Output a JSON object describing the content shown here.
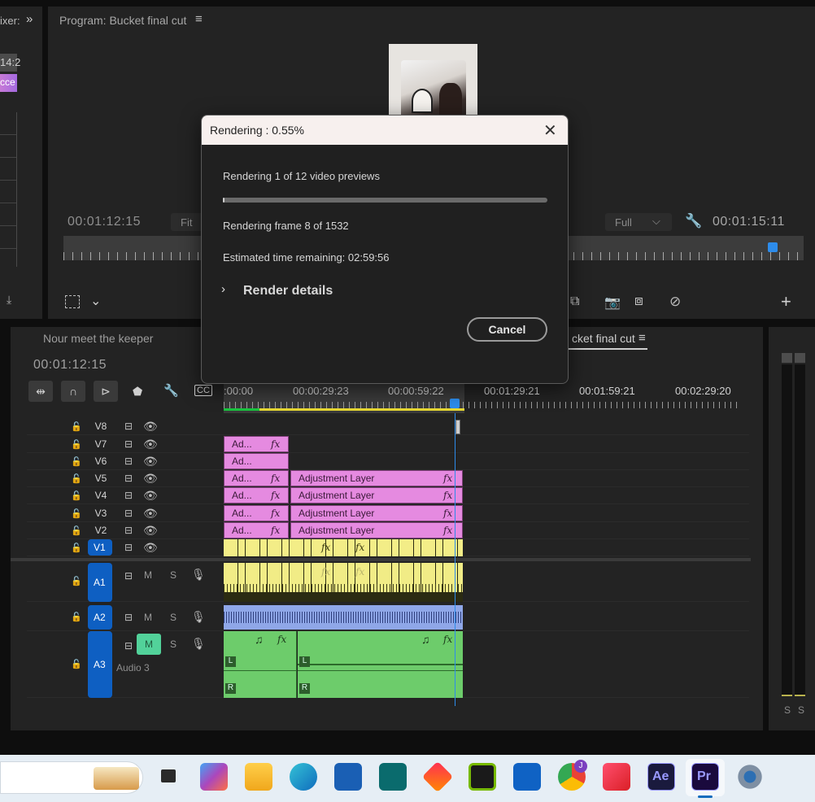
{
  "left_panel": {
    "tab_fragment": "ixer:",
    "timecode_fragment": "14:2",
    "clip_fragment": "cce"
  },
  "program_monitor": {
    "title": "Program: Bucket final cut",
    "timecode_left": "00:01:12:15",
    "fit_label": "Fit",
    "quality_label": "Full",
    "timecode_right": "00:01:15:11"
  },
  "timeline": {
    "tab_left": "Nour meet the keeper",
    "tab_right": "cket final cut",
    "timecode": "00:01:12:15",
    "ruler_labels": [
      ":00:00",
      "00:00:29:23",
      "00:00:59:22",
      "00:01:29:21",
      "00:01:59:21",
      "00:02:29:20"
    ],
    "tracks": [
      {
        "name": "V8"
      },
      {
        "name": "V7"
      },
      {
        "name": "V6"
      },
      {
        "name": "V5"
      },
      {
        "name": "V4"
      },
      {
        "name": "V3"
      },
      {
        "name": "V2"
      },
      {
        "name": "V1"
      }
    ],
    "audio_tracks": [
      {
        "name": "A1"
      },
      {
        "name": "A2"
      },
      {
        "name": "A3",
        "label": "Audio 3"
      }
    ],
    "clip_short": "Ad...",
    "clip_long": "Adjustment Layer",
    "fx_symbol": "fx",
    "mute_label": "M",
    "solo_label": "S",
    "channel_left": "L",
    "channel_right": "R"
  },
  "meter": {
    "s1": "S",
    "s2": "S"
  },
  "dialog": {
    "title": "Rendering : 0.55%",
    "status_line": "Rendering 1 of 12 video previews",
    "progress_fraction": 0.0055,
    "frame_line": "Rendering frame 8 of 1532",
    "eta_line": "Estimated time remaining: 02:59:56",
    "details_label": "Render details",
    "cancel_label": "Cancel"
  },
  "colors": {
    "adjustment_clip": "#e58ae0",
    "video_clip": "#f3ed87",
    "audio_a2": "#8fa7e8",
    "audio_a3": "#6dcc6b",
    "track_target": "#0e5fc2",
    "playhead": "#2d8ceb"
  },
  "taskbar": {
    "icons": [
      "task-view-icon",
      "copilot-icon",
      "file-explorer-icon",
      "edge-icon",
      "store-icon",
      "sway-icon",
      "app-red-icon",
      "nvidia-icon",
      "outlook-icon",
      "chrome-icon",
      "creative-cloud-icon",
      "after-effects-icon",
      "premiere-icon",
      "settings-icon"
    ],
    "ae_label": "Ae",
    "pr_label": "Pr",
    "chrome_badge": "J"
  }
}
